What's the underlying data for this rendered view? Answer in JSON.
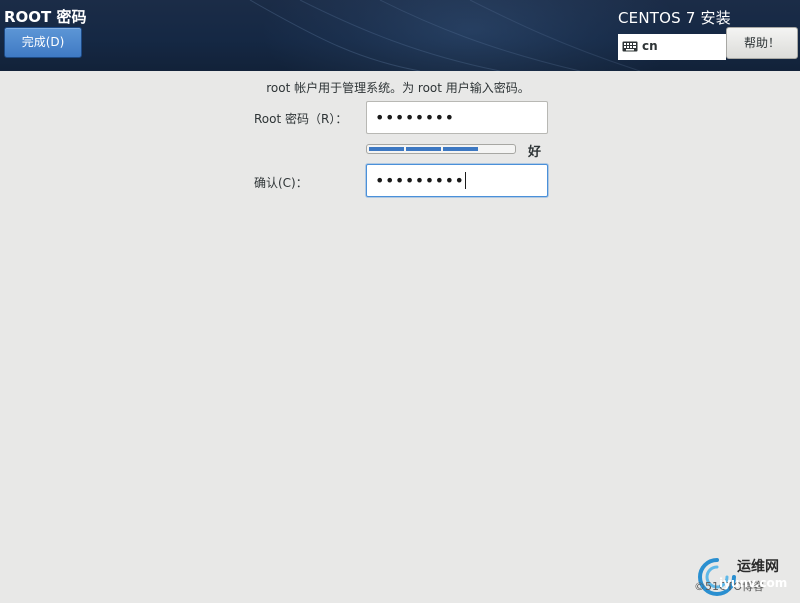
{
  "header": {
    "page_title": "ROOT 密码",
    "done_button": "完成(D)",
    "product_title": "CENTOS 7 安装",
    "keyboard_layout": "cn",
    "help_button": "帮助！"
  },
  "form": {
    "intro": "root 帐户用于管理系统。为 root 用户输入密码。",
    "root_password_label": "Root 密码（R）：",
    "root_password_value": "••••••••",
    "strength": {
      "level": 0.75,
      "label": "好"
    },
    "confirm_label": "确认(C)：",
    "confirm_value": "•••••••••"
  },
  "watermark": {
    "name": "运维网",
    "url": "iyunv.com",
    "copyright": "©51CTO博客"
  },
  "colors": {
    "header_bg": "#152844",
    "done_button": "#3f7ac4",
    "focus_ring": "#4a90d9",
    "strength_fill": "#3d78c2",
    "body_bg": "#e8e8e7"
  },
  "icons": [
    "keyboard-icon",
    "watermark-logo-icon"
  ]
}
